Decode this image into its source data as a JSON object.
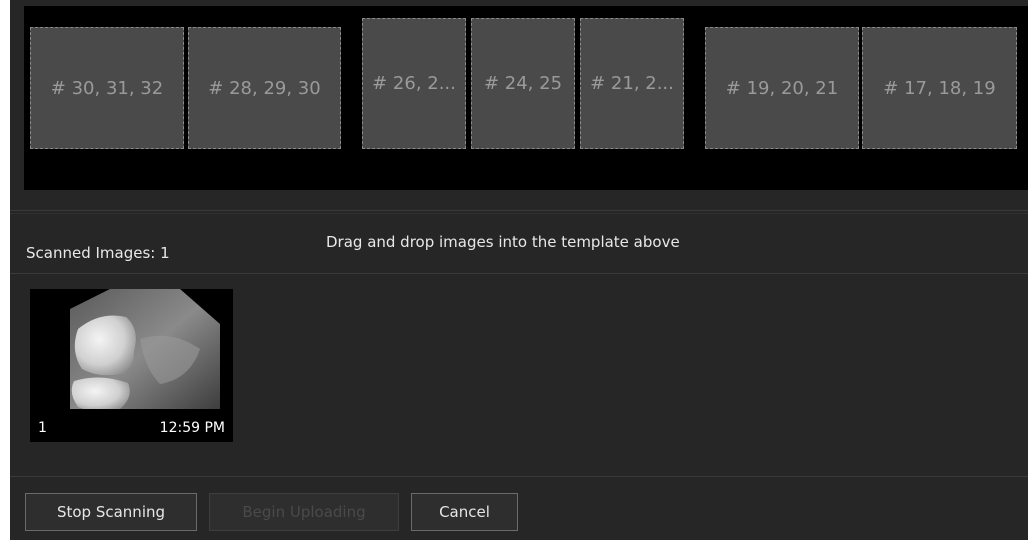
{
  "template": {
    "slots": [
      {
        "label": "# 30, 31, 32"
      },
      {
        "label": "# 28, 29, 30"
      },
      {
        "label": "# 26, 2..."
      },
      {
        "label": "# 24, 25"
      },
      {
        "label": "# 21, 2..."
      },
      {
        "label": "# 19, 20, 21"
      },
      {
        "label": "# 17, 18, 19"
      }
    ]
  },
  "scan": {
    "count_label": "Scanned Images: 1",
    "instructions": "Drag and drop images into the template above"
  },
  "thumbnails": [
    {
      "index": "1",
      "time": "12:59 PM"
    }
  ],
  "actions": {
    "stop_scanning": "Stop Scanning",
    "begin_uploading": "Begin Uploading",
    "cancel": "Cancel"
  }
}
